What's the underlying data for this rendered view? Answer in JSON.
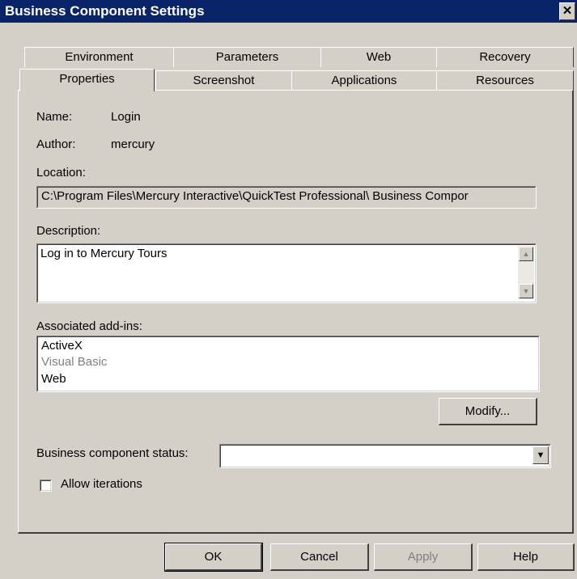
{
  "window": {
    "title": "Business Component Settings",
    "close_glyph": "✕"
  },
  "tabs": {
    "row_back": [
      "Environment",
      "Parameters",
      "Web",
      "Recovery"
    ],
    "row_front": [
      "Properties",
      "Screenshot",
      "Applications",
      "Resources"
    ],
    "active": "Properties"
  },
  "properties": {
    "name_label": "Name:",
    "name_value": "Login",
    "author_label": "Author:",
    "author_value": "mercury",
    "location_label": "Location:",
    "location_value": "C:\\Program Files\\Mercury Interactive\\QuickTest Professional\\ Business Compor",
    "description_label": "Description:",
    "description_value": "Log in to Mercury Tours",
    "addins_label": "Associated add-ins:",
    "addins": [
      {
        "label": "ActiveX",
        "enabled": true
      },
      {
        "label": "Visual Basic",
        "enabled": false
      },
      {
        "label": "Web",
        "enabled": true
      }
    ],
    "modify_button": "Modify...",
    "status_label": "Business component status:",
    "status_value": "",
    "allow_iterations_label": "Allow iterations",
    "allow_iterations_checked": false
  },
  "footer": {
    "ok": "OK",
    "cancel": "Cancel",
    "apply": "Apply",
    "help": "Help"
  },
  "icons": {
    "scroll_up": "▲",
    "scroll_down": "▼",
    "dropdown": "▼"
  }
}
